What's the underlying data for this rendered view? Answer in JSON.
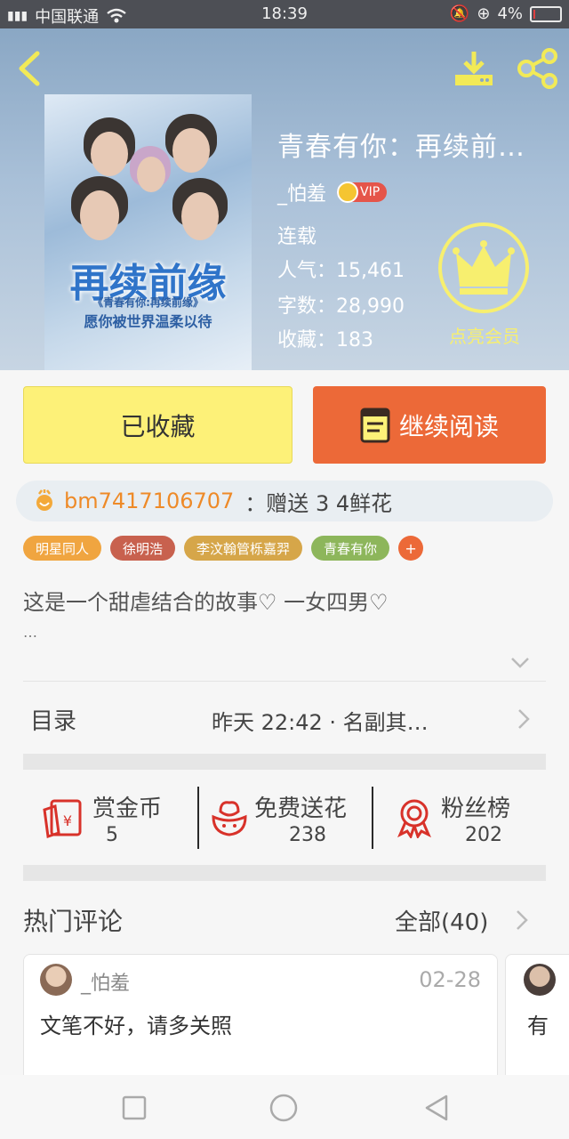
{
  "status_bar": {
    "carrier": "中国联通",
    "time": "18:39",
    "battery": "4%",
    "battery_level": 0.04
  },
  "book": {
    "title": "青春有你：再续前…",
    "author": "_怕羞",
    "vip_badge": "VIP",
    "status": "连载",
    "popularity_label": "人气：15,461",
    "word_count_label": "字数：28,990",
    "favorites_label": "收藏：183",
    "member_label": "点亮会员",
    "cover": {
      "title": "再续前缘",
      "subtitle": "《青春有你:再续前缘》",
      "tagline": "愿你被世界温柔以待"
    }
  },
  "actions": {
    "favorited_label": "已收藏",
    "continue_label": "继续阅读"
  },
  "gift": {
    "user": "bm7417106707",
    "message": "：赠送 3 4鲜花"
  },
  "tags": [
    {
      "label": "明星同人",
      "color": "#f0a540"
    },
    {
      "label": "徐明浩",
      "color": "#c8614e"
    },
    {
      "label": "李汶翰管栎嘉羿",
      "color": "#d6a649"
    },
    {
      "label": "青春有你",
      "color": "#8db65b"
    }
  ],
  "tag_add": "+",
  "description": {
    "text": "这是一个甜虐结合的故事♡ 一女四男♡",
    "more": "…"
  },
  "catalog": {
    "label": "目录",
    "latest": "昨天 22:42 · 名副其…"
  },
  "stats": [
    {
      "name": "赏金币",
      "value": "5",
      "icon": "red-envelope-icon"
    },
    {
      "name": "免费送花",
      "value": "238",
      "icon": "flower-icon"
    },
    {
      "name": "粉丝榜",
      "value": "202",
      "icon": "medal-icon"
    }
  ],
  "hot_comments": {
    "title": "热门评论",
    "all_label": "全部(40)",
    "items": [
      {
        "user": "_怕羞",
        "date": "02-28",
        "text": "文笔不好，请多关照"
      },
      {
        "user": "",
        "date": "",
        "text": "有"
      }
    ]
  },
  "colors": {
    "accent_orange": "#ec6938",
    "fav_yellow": "#fdf178",
    "member_yellow": "#f7ef6f"
  }
}
